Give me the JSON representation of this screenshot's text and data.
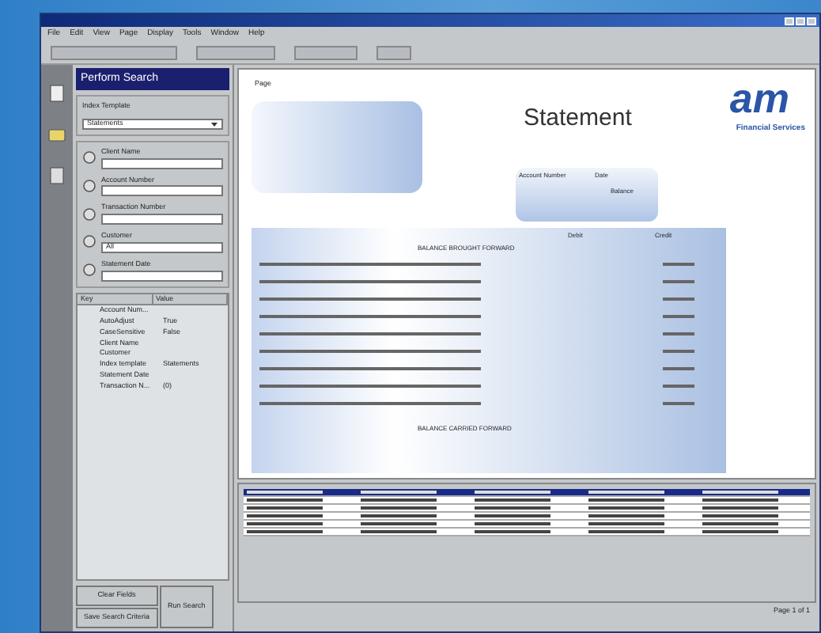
{
  "menu": [
    "File",
    "Edit",
    "View",
    "Page",
    "Display",
    "Tools",
    "Window",
    "Help"
  ],
  "search_panel": {
    "title": "Perform Search",
    "index_template": {
      "label": "Index Template",
      "value": "Statements"
    },
    "fields": [
      {
        "label": "Client Name"
      },
      {
        "label": "Account Number"
      },
      {
        "label": "Transaction Number"
      },
      {
        "label": "Customer",
        "value": "All"
      },
      {
        "label": "Statement Date"
      }
    ],
    "properties": {
      "columns": [
        "Key",
        "Value"
      ],
      "rows": [
        {
          "key": "Account Num..."
        },
        {
          "key": "AutoAdjust",
          "value": "True"
        },
        {
          "key": "CaseSensitive",
          "value": "False"
        },
        {
          "key": "Client Name"
        },
        {
          "key": "Customer"
        },
        {
          "key": "Index template",
          "value": "Statements"
        },
        {
          "key": "Statement Date"
        },
        {
          "key": "Transaction N...",
          "value": "(0)"
        }
      ]
    },
    "buttons": [
      "Clear Fields",
      "Save Search Criteria",
      "Run Search"
    ]
  },
  "statement": {
    "page_label": "Page",
    "title": "Statement",
    "logo": "am",
    "logo_caption": "Financial Services",
    "summary_labels": [
      "Account Number",
      "Date",
      "Balance"
    ],
    "columns": [
      "Debit",
      "Credit"
    ],
    "opening": "BALANCE BROUGHT FORWARD",
    "closing": "BALANCE CARRIED FORWARD",
    "transactions": [
      {
        "kind": "line"
      },
      {
        "kind": "line"
      },
      {
        "kind": "line"
      },
      {
        "kind": "line"
      },
      {
        "kind": "line"
      },
      {
        "kind": "line"
      },
      {
        "kind": "line"
      },
      {
        "kind": "line"
      },
      {
        "kind": "line"
      }
    ]
  },
  "results": {
    "rows": [
      {
        "selected": true
      },
      {
        "selected": false
      },
      {
        "selected": false
      },
      {
        "selected": false
      },
      {
        "selected": false
      },
      {
        "selected": false
      }
    ]
  },
  "status_bar": {
    "page": "Page 1 of 1"
  }
}
